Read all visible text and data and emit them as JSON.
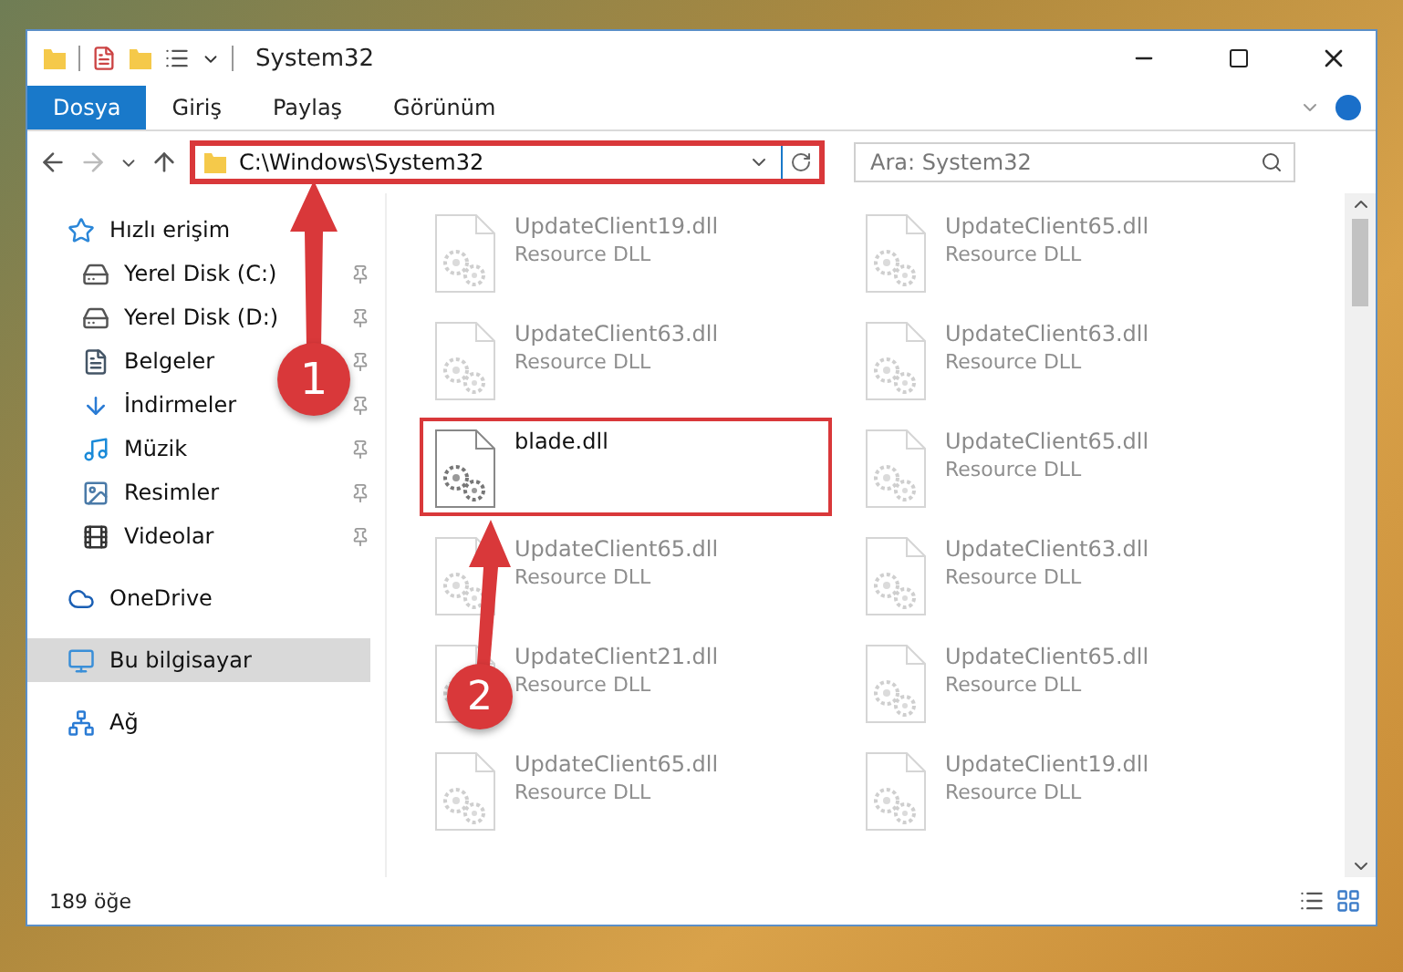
{
  "window": {
    "title": "System32"
  },
  "ribbon_tabs": [
    {
      "label": "Dosya",
      "selected": true
    },
    {
      "label": "Giriş",
      "selected": false
    },
    {
      "label": "Paylaş",
      "selected": false
    },
    {
      "label": "Görünüm",
      "selected": false
    }
  ],
  "address_bar": {
    "path": "C:\\Windows\\System32",
    "highlighted": true
  },
  "search": {
    "placeholder": "Ara: System32"
  },
  "sidebar": {
    "items": [
      {
        "label": "Hızlı erişim",
        "kind": "quick",
        "selected": false,
        "children": [
          {
            "label": "Yerel Disk (C:)",
            "kind": "diskc",
            "pinned": true,
            "selected": false
          },
          {
            "label": "Yerel Disk (D:)",
            "kind": "disk",
            "pinned": true,
            "selected": false
          },
          {
            "label": "Belgeler",
            "kind": "docs",
            "pinned": true,
            "selected": false
          },
          {
            "label": "İndirmeler",
            "kind": "down",
            "pinned": true,
            "selected": false
          },
          {
            "label": "Müzik",
            "kind": "music",
            "pinned": true,
            "selected": false
          },
          {
            "label": "Resimler",
            "kind": "pics",
            "pinned": true,
            "selected": false
          },
          {
            "label": "Videolar",
            "kind": "video",
            "pinned": true,
            "selected": false
          }
        ]
      },
      {
        "label": "OneDrive",
        "kind": "cloud",
        "selected": false
      },
      {
        "label": "Bu bilgisayar",
        "kind": "pc",
        "selected": true
      },
      {
        "label": "Ağ",
        "kind": "net",
        "selected": false
      }
    ]
  },
  "files": [
    {
      "name": "UpdateClient19.dll",
      "description": "Resource DLL",
      "faded": true,
      "highlighted": false
    },
    {
      "name": "UpdateClient65.dll",
      "description": "Resource DLL",
      "faded": true,
      "highlighted": false
    },
    {
      "name": "UpdateClient63.dll",
      "description": "Resource DLL",
      "faded": true,
      "highlighted": false
    },
    {
      "name": "UpdateClient63.dll",
      "description": "Resource DLL",
      "faded": true,
      "highlighted": false
    },
    {
      "name": "blade.dll",
      "faded": false,
      "highlighted": true
    },
    {
      "name": "UpdateClient65.dll",
      "description": "Resource DLL",
      "faded": true,
      "highlighted": false
    },
    {
      "name": "UpdateClient65.dll",
      "description": "Resource DLL",
      "faded": true,
      "highlighted": false
    },
    {
      "name": "UpdateClient63.dll",
      "description": "Resource DLL",
      "faded": true,
      "highlighted": false
    },
    {
      "name": "UpdateClient21.dll",
      "description": "Resource DLL",
      "faded": true,
      "highlighted": false
    },
    {
      "name": "UpdateClient65.dll",
      "description": "Resource DLL",
      "faded": true,
      "highlighted": false
    },
    {
      "name": "UpdateClient65.dll",
      "description": "Resource DLL",
      "faded": true,
      "highlighted": false
    },
    {
      "name": "UpdateClient19.dll",
      "description": "Resource DLL",
      "faded": true,
      "highlighted": false
    }
  ],
  "annotations": [
    {
      "label": "1"
    },
    {
      "label": "2"
    }
  ],
  "status_bar": {
    "count": "189 öğe"
  }
}
